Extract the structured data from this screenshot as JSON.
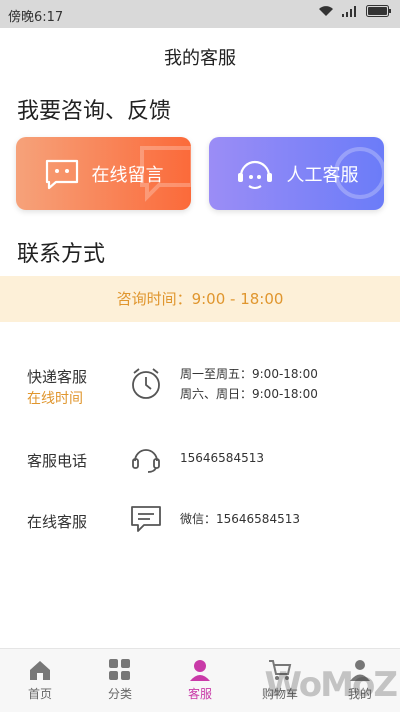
{
  "status_bar": {
    "time": "傍晚6:17"
  },
  "header": {
    "title": "我的客服"
  },
  "consult": {
    "title": "我要咨询、反馈",
    "buttons": [
      {
        "label": "在线留言",
        "icon": "chat-bubble-icon"
      },
      {
        "label": "人工客服",
        "icon": "headset-face-icon"
      }
    ]
  },
  "contact": {
    "title": "联系方式",
    "hours_banner": "咨询时间：9:00 - 18:00",
    "rows": [
      {
        "label": "快递客服",
        "sub": "在线时间",
        "icon": "clock-icon",
        "lines": [
          "周一至周五：9:00-18:00",
          "周六、周日：9:00-18:00"
        ]
      },
      {
        "label": "客服电话",
        "icon": "headset-icon",
        "lines": [
          "15646584513"
        ]
      },
      {
        "label": "在线客服",
        "icon": "message-icon",
        "lines": [
          "微信：15646584513"
        ]
      }
    ]
  },
  "tabbar": {
    "items": [
      {
        "label": "首页",
        "icon": "home-icon"
      },
      {
        "label": "分类",
        "icon": "grid-icon"
      },
      {
        "label": "客服",
        "icon": "customer-service-icon"
      },
      {
        "label": "购物车",
        "icon": "cart-icon"
      },
      {
        "label": "我的",
        "icon": "profile-icon"
      }
    ],
    "active_index": 2
  },
  "watermark": "WoMoZ",
  "colors": {
    "accent": "#c93aa8",
    "warm": "#e0962e",
    "banner_bg": "#fdf0d8"
  }
}
